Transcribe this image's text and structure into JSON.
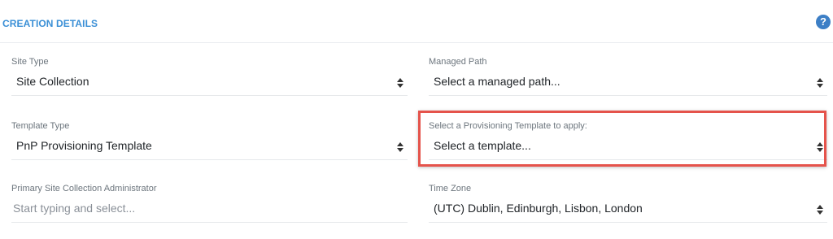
{
  "section": {
    "title": "CREATION DETAILS",
    "help_icon": "question-circle-icon",
    "accent_color": "#3a8fd6"
  },
  "fields": {
    "site_type": {
      "label": "Site Type",
      "value": "Site Collection",
      "icon": "sort-arrows-icon"
    },
    "managed_path": {
      "label": "Managed Path",
      "value": "Select a managed path...",
      "icon": "sort-arrows-icon"
    },
    "template_type": {
      "label": "Template Type",
      "value": "PnP Provisioning Template",
      "icon": "sort-arrows-icon"
    },
    "provisioning_template": {
      "label": "Select a Provisioning Template to apply:",
      "value": "Select a template...",
      "icon": "sort-arrows-icon",
      "highlight_color": "#e5534b"
    },
    "primary_admin": {
      "label": "Primary Site Collection Administrator",
      "placeholder": "Start typing and select..."
    },
    "time_zone": {
      "label": "Time Zone",
      "value": "(UTC) Dublin, Edinburgh, Lisbon, London",
      "icon": "sort-arrows-icon"
    }
  }
}
